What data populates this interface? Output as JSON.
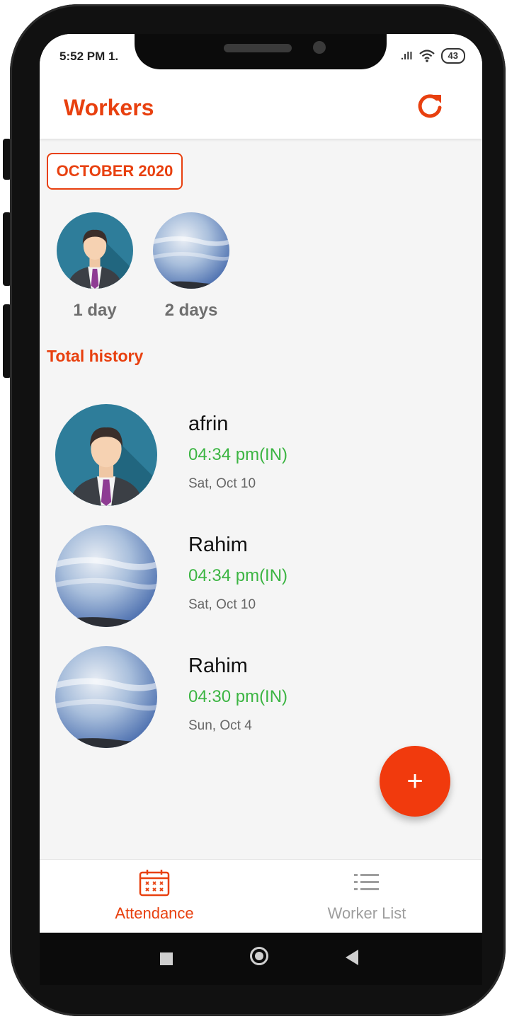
{
  "status_bar": {
    "time": "5:52 PM 1.",
    "signal": ".ıll",
    "battery": "43"
  },
  "app_bar": {
    "title": "Workers",
    "refresh_icon": "refresh-icon"
  },
  "month_filter": {
    "label": "OCTOBER 2020"
  },
  "summary": [
    {
      "avatar": "person-avatar",
      "label": "1 day"
    },
    {
      "avatar": "sky-photo-avatar",
      "label": "2 days"
    }
  ],
  "history": {
    "title": "Total history",
    "entries": [
      {
        "avatar": "person-avatar",
        "name": "afrin",
        "time": "04:34 pm(IN)",
        "date": "Sat, Oct 10"
      },
      {
        "avatar": "sky-photo-avatar",
        "name": "Rahim",
        "time": "04:34 pm(IN)",
        "date": "Sat, Oct 10"
      },
      {
        "avatar": "sky-photo-avatar",
        "name": "Rahim",
        "time": "04:30 pm(IN)",
        "date": "Sun, Oct 4"
      }
    ]
  },
  "fab": {
    "label": "+"
  },
  "bottom_nav": {
    "items": [
      {
        "label": "Attendance",
        "icon": "calendar-icon",
        "active": true
      },
      {
        "label": "Worker List",
        "icon": "list-icon",
        "active": false
      }
    ]
  },
  "colors": {
    "accent": "#e8400f",
    "in_time": "#3cb543",
    "fab": "#f13a0d"
  }
}
